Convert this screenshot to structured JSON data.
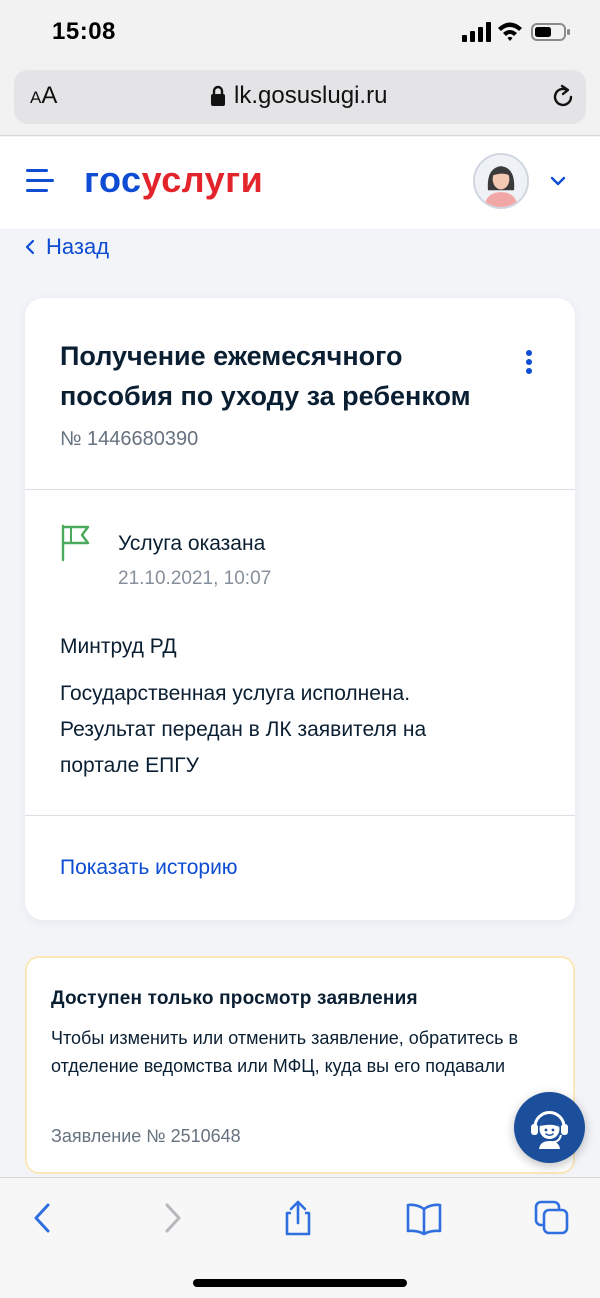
{
  "status_bar": {
    "time": "15:08",
    "icons": [
      "signal-icon",
      "wifi-icon",
      "battery-icon"
    ]
  },
  "browser": {
    "text_size_label_small": "A",
    "text_size_label_large": "A",
    "url": "lk.gosuslugi.ru",
    "icons": [
      "lock-icon",
      "reload-icon"
    ]
  },
  "header": {
    "logo_part1": "гос",
    "logo_part2": "услуги",
    "icons": [
      "menu-icon",
      "avatar",
      "chevron-down-icon"
    ],
    "colors": {
      "brand_blue": "#0d4cd3",
      "brand_red": "#e3242b"
    }
  },
  "back_link": {
    "label": "Назад"
  },
  "application": {
    "title": "Получение ежемесячного пособия по уходу за ребенком",
    "number": "№ 1446680390",
    "status": {
      "label": "Услуга оказана",
      "datetime": "21.10.2021, 10:07",
      "icon": "flag-icon",
      "color": "#4aaa5e"
    },
    "organization": "Минтруд РД",
    "result_text": "Государственная услуга исполнена. Результат передан в ЛК заявителя на портале ЕПГУ",
    "history_link": "Показать историю"
  },
  "notice": {
    "title": "Доступен только просмотр заявления",
    "body": "Чтобы изменить или отменить заявление, обратитесь в отделение ведомства или МФЦ, куда вы его подавали",
    "number": "Заявление № 2510648",
    "border_color": "#fbe7b8"
  },
  "support": {
    "icon": "support-operator-icon"
  },
  "toolbar": {
    "icons": [
      "back-icon",
      "forward-icon",
      "share-icon",
      "bookmarks-icon",
      "tabs-icon"
    ]
  }
}
